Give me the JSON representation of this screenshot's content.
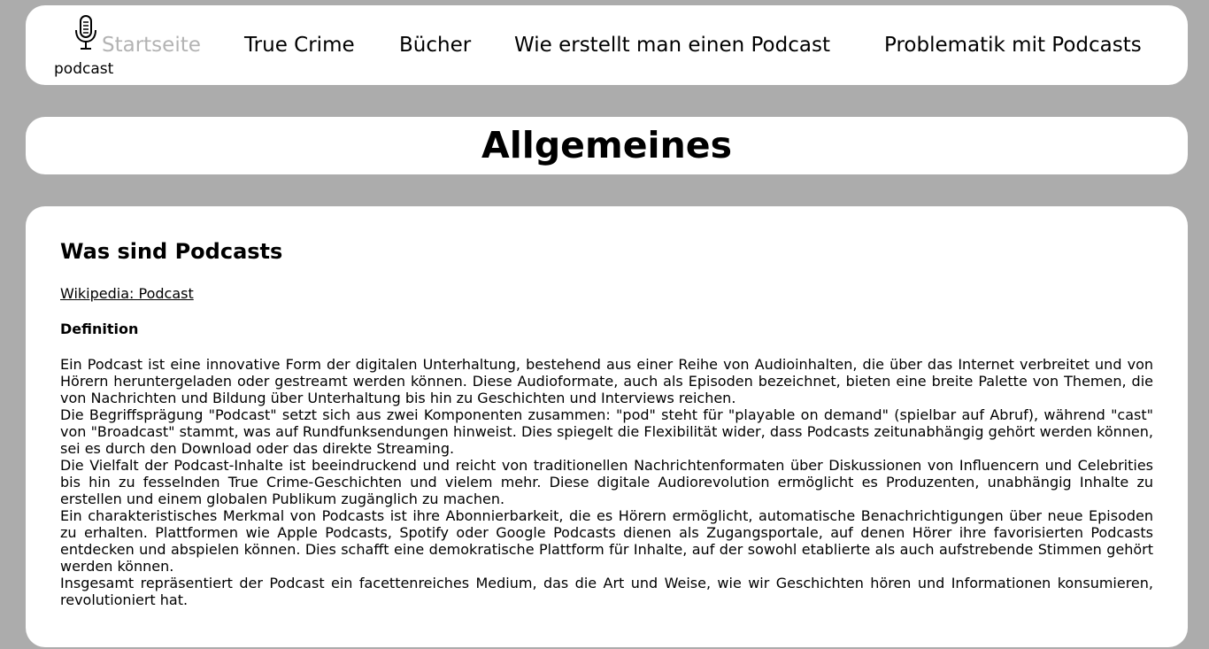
{
  "nav": {
    "logo_text": "podcast",
    "links": [
      {
        "label": "Startseite",
        "active": true
      },
      {
        "label": "True Crime",
        "active": false
      },
      {
        "label": "Bücher",
        "active": false
      },
      {
        "label": "Wie erstellt man einen Podcast",
        "active": false
      },
      {
        "label": "Problematik mit Podcasts",
        "active": false
      }
    ]
  },
  "heading": "Allgemeines",
  "content": {
    "title": "Was sind Podcasts",
    "wiki_link": "Wikipedia: Podcast",
    "definition_label": "Definition",
    "paragraphs": [
      "Ein Podcast ist eine innovative Form der digitalen Unterhaltung, bestehend aus einer Reihe von Audioinhalten, die über das Internet verbreitet und von Hörern heruntergeladen oder gestreamt werden können. Diese Audioformate, auch als Episoden bezeichnet, bieten eine breite Palette von Themen, die von Nachrichten und Bildung über Unterhaltung bis hin zu Geschichten und Interviews reichen.",
      "Die Begriffsprägung \"Podcast\" setzt sich aus zwei Komponenten zusammen: \"pod\" steht für \"playable on demand\" (spielbar auf Abruf), während \"cast\" von \"Broadcast\" stammt, was auf Rundfunksendungen hinweist. Dies spiegelt die Flexibilität wider, dass Podcasts zeitunabhängig gehört werden können, sei es durch den Download oder das direkte Streaming.",
      "Die Vielfalt der Podcast-Inhalte ist beeindruckend und reicht von traditionellen Nachrichtenformaten über Diskussionen von Influencern und Celebrities bis hin zu fesselnden True Crime-Geschichten und vielem mehr. Diese digitale Audiorevolution ermöglicht es Produzenten, unabhängig Inhalte zu erstellen und einem globalen Publikum zugänglich zu machen.",
      "Ein charakteristisches Merkmal von Podcasts ist ihre Abonnierbarkeit, die es Hörern ermöglicht, automatische Benachrichtigungen über neue Episoden zu erhalten. Plattformen wie Apple Podcasts, Spotify oder Google Podcasts dienen als Zugangsportale, auf denen Hörer ihre favorisierten Podcasts entdecken und abspielen können. Dies schafft eine demokratische Plattform für Inhalte, auf der sowohl etablierte als auch aufstrebende Stimmen gehört werden können.",
      "Insgesamt repräsentiert der Podcast ein facettenreiches Medium, das die Art und Weise, wie wir Geschichten hören und Informationen konsumieren, revolutioniert hat."
    ]
  }
}
